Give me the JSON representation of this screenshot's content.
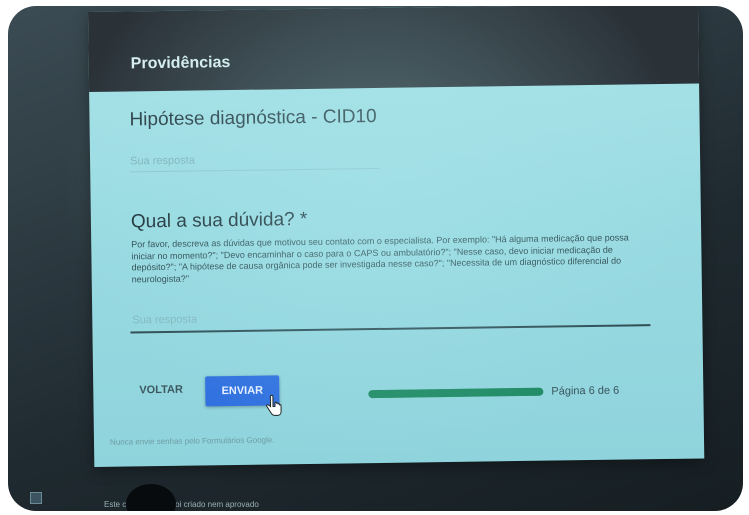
{
  "section": {
    "title": "Providências"
  },
  "question1": {
    "title": "Hipótese diagnóstica - CID10",
    "placeholder": "Sua resposta"
  },
  "question2": {
    "title": "Qual a sua dúvida? *",
    "help_text": "Por favor, descreva as dúvidas que motivou seu contato com o especialista. Por exemplo: \"Há alguma medicação que possa iniciar no momento?\"; \"Devo encaminhar o caso para o CAPS ou ambulatório?\"; \"Nesse caso, devo iniciar medicação de depósito?\"; \"A hipótese de causa orgânica pode ser investigada nesse caso?\"; \"Necessita de um diagnóstico diferencial do neurologista?\"",
    "placeholder": "Sua resposta"
  },
  "navigation": {
    "back_label": "VOLTAR",
    "submit_label": "ENVIAR"
  },
  "progress": {
    "fraction": 1.0,
    "page_label": "Página 6 de 6"
  },
  "footer": {
    "note": "Nunca envie senhas pelo Formulários Google.",
    "disclaimer": "Este conteúdo não foi criado nem aprovado"
  },
  "colors": {
    "header_bg": "#2a3238",
    "submit_button": "#2f6fe0",
    "progress_fill": "#1f8a63"
  },
  "icons": {
    "cursor": "hand-pointer-icon"
  }
}
